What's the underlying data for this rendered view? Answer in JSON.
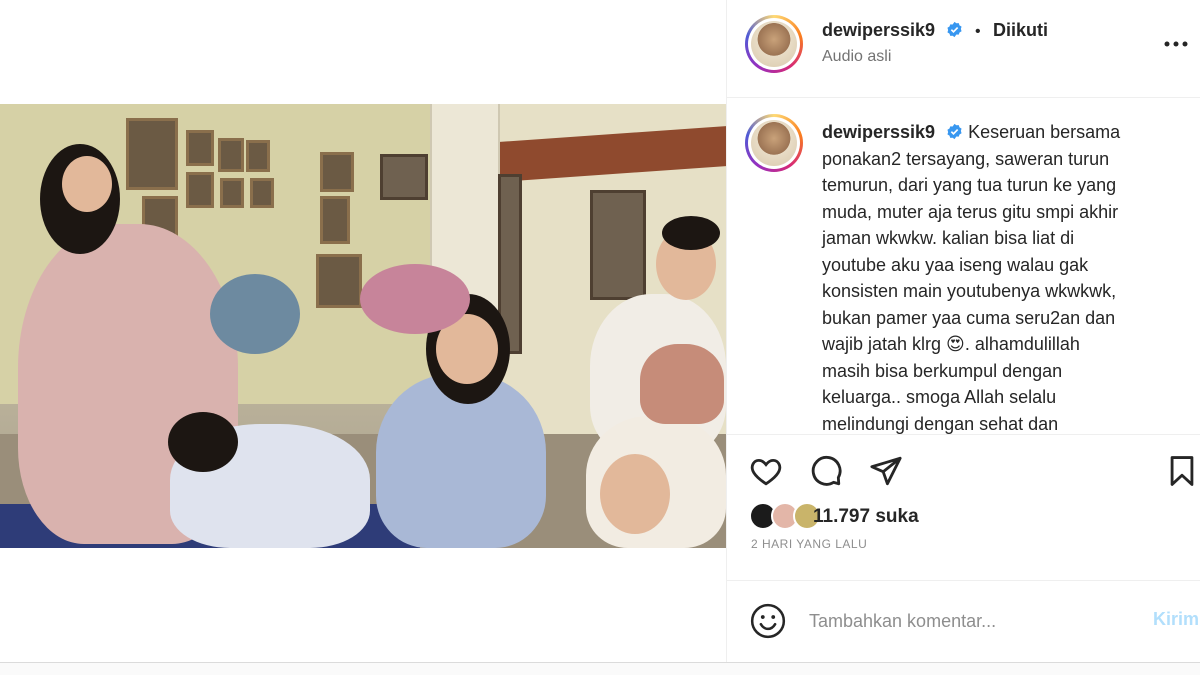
{
  "post": {
    "username": "dewiperssik9",
    "follow_status": "Diikuti",
    "separator": "•",
    "audio_label": "Audio asli",
    "caption_lines": [
      "Keseruan bersama",
      "ponakan2 tersayang, saweran turun",
      "temurun, dari yang tua turun ke yang",
      "muda, muter aja terus gitu smpi akhir",
      "jaman wkwkw. kalian bisa liat di",
      "youtube aku yaa iseng walau gak",
      "konsisten main youtubenya wkwkwk,",
      "bukan pamer yaa cuma seru2an dan",
      "wajib jatah klrg 😍. alhamdulillah",
      "masih bisa berkumpul dengan",
      "keluarga.. smoga Allah selalu",
      "melindungi dengan sehat dan"
    ],
    "likes_text": "11.797 suka",
    "time_text": "2 HARI YANG LALU"
  },
  "icons": {
    "verified": "verified-badge-icon",
    "more": "more-options-icon",
    "like": "heart-icon",
    "comment": "comment-icon",
    "share": "share-icon",
    "save": "bookmark-icon",
    "emoji": "emoji-icon",
    "mute": "speaker-muted-icon"
  },
  "comment_box": {
    "placeholder": "Tambahkan komentar...",
    "post_label": "Kirim"
  },
  "colors": {
    "verified_blue": "#3897f0",
    "post_button_disabled": "#b2dffc",
    "secondary_text": "#8e8e8e"
  }
}
